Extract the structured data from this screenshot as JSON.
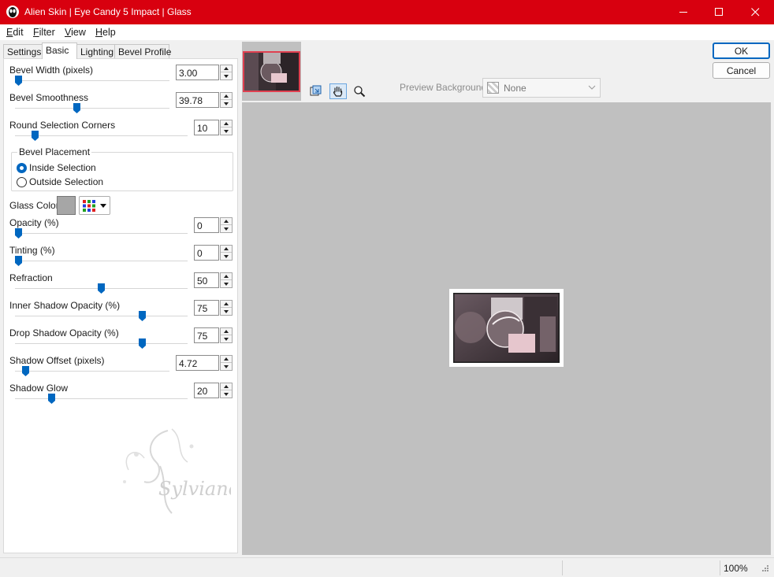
{
  "window": {
    "title": "Alien Skin | Eye Candy 5 Impact | Glass",
    "minimize_icon": "minimize-icon",
    "maximize_icon": "maximize-icon",
    "close_icon": "close-icon"
  },
  "menu": {
    "items": [
      {
        "mnemonic": "E",
        "rest": "dit"
      },
      {
        "mnemonic": "F",
        "rest": "ilter"
      },
      {
        "mnemonic": "V",
        "rest": "iew"
      },
      {
        "mnemonic": "H",
        "rest": "elp"
      }
    ]
  },
  "tabs": [
    {
      "label": "Settings",
      "active": false
    },
    {
      "label": "Basic",
      "active": true
    },
    {
      "label": "Lighting",
      "active": false
    },
    {
      "label": "Bevel Profile",
      "active": false
    }
  ],
  "basic": {
    "bevel_width": {
      "label": "Bevel Width (pixels)",
      "value": "3.00",
      "level": 0.0
    },
    "bevel_smoothness": {
      "label": "Bevel Smoothness",
      "value": "39.78",
      "level": 0.4
    },
    "round_corners": {
      "label": "Round Selection Corners",
      "value": "10",
      "level": 0.1
    },
    "bevel_placement": {
      "title": "Bevel Placement",
      "options": [
        "Inside Selection",
        "Outside Selection"
      ],
      "selected": "Inside Selection"
    },
    "glass_color": {
      "label": "Glass Color",
      "swatch": "#a6a6a6"
    },
    "opacity": {
      "label": "Opacity (%)",
      "value": "0",
      "level": 0.0
    },
    "tinting": {
      "label": "Tinting (%)",
      "value": "0",
      "level": 0.0
    },
    "refraction": {
      "label": "Refraction",
      "value": "50",
      "level": 0.5
    },
    "inner_shadow": {
      "label": "Inner Shadow Opacity (%)",
      "value": "75",
      "level": 0.75
    },
    "drop_shadow": {
      "label": "Drop Shadow Opacity (%)",
      "value": "75",
      "level": 0.75
    },
    "shadow_offset": {
      "label": "Shadow Offset (pixels)",
      "value": "4.72",
      "level": 0.05
    },
    "shadow_glow": {
      "label": "Shadow Glow",
      "value": "20",
      "level": 0.2
    }
  },
  "watermark": {
    "text": "Sylviane"
  },
  "preview": {
    "background_label": "Preview Background:",
    "background_value": "None",
    "tools": [
      "navigate-icon",
      "hand-icon",
      "zoom-icon"
    ]
  },
  "buttons": {
    "ok": "OK",
    "cancel": "Cancel"
  },
  "status": {
    "zoom": "100%"
  },
  "colors": {
    "titlebar": "#d8000f",
    "accent": "#0067c0",
    "preview_bg": "#c0c0c0"
  }
}
